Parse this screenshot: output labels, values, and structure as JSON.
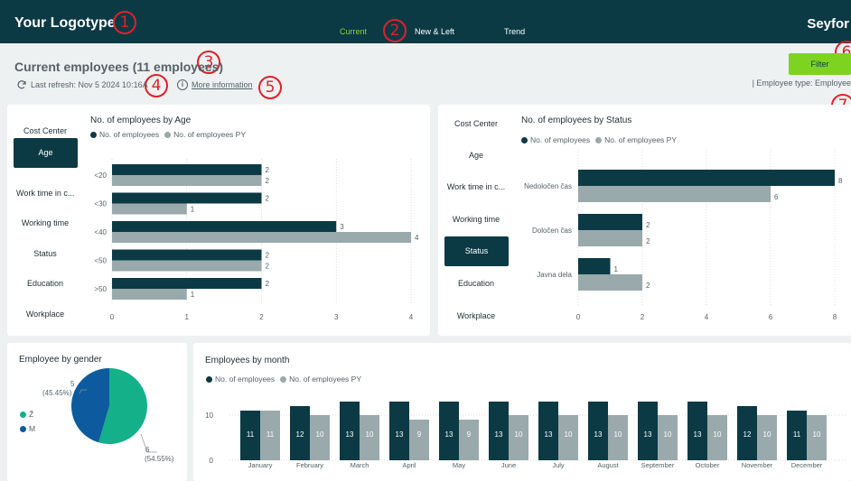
{
  "header": {
    "logo": "Your Logotype",
    "brand": "Seyfor",
    "tabs": [
      {
        "label": "Current",
        "active": true
      },
      {
        "label": "New & Left",
        "active": false
      },
      {
        "label": "Trend",
        "active": false
      }
    ]
  },
  "markers": [
    "1",
    "2",
    "3",
    "4",
    "5",
    "6",
    "7"
  ],
  "page": {
    "title": "Current employees (11 employees)",
    "refresh_text": "Last refresh: Nov 5 2024 10:16A",
    "more_info_label": "More information",
    "info_icon_glyph": "i",
    "filter_label": "Filter",
    "filter_summary": "| Employee type: Employee"
  },
  "colors": {
    "dark": "#0b3a45",
    "light": "#9aa9ab",
    "accent": "#7ed321",
    "female": "#14b08a",
    "male": "#0d5b9e"
  },
  "legend": {
    "current": "No. of employees",
    "previous": "No. of employees PY"
  },
  "left_panel": {
    "menu": [
      "Cost Center",
      "Age",
      "Work time in c...",
      "Working time",
      "Status",
      "Education",
      "Workplace"
    ],
    "selected": "Age"
  },
  "right_panel": {
    "menu": [
      "Cost Center",
      "Age",
      "Work time in c...",
      "Working time",
      "Status",
      "Education",
      "Workplace"
    ],
    "selected": "Status"
  },
  "gender_card": {
    "title": "Employee by gender",
    "legend": [
      "Ž",
      "M"
    ]
  },
  "chart_data": [
    {
      "type": "bar",
      "orientation": "horizontal",
      "title": "No. of employees by Age",
      "categories": [
        "<20",
        "<30",
        "<40",
        "<50",
        ">50"
      ],
      "series": [
        {
          "name": "No. of employees",
          "values": [
            2,
            2,
            3,
            2,
            2
          ]
        },
        {
          "name": "No. of employees PY",
          "values": [
            2,
            1,
            4,
            2,
            1
          ]
        }
      ],
      "xlim": [
        0,
        4
      ],
      "xticks": [
        "0",
        "1",
        "2",
        "3",
        "4"
      ],
      "grid": true,
      "legend": "top-left"
    },
    {
      "type": "bar",
      "orientation": "horizontal",
      "title": "No. of employees by Status",
      "categories": [
        "Nedoločen čas",
        "Določen čas",
        "Javna dela"
      ],
      "series": [
        {
          "name": "No. of employees",
          "values": [
            8,
            2,
            1
          ]
        },
        {
          "name": "No. of employees PY",
          "values": [
            6,
            2,
            2
          ]
        }
      ],
      "xlim": [
        0,
        8
      ],
      "xticks": [
        "0",
        "2",
        "4",
        "6",
        "8"
      ],
      "grid": true,
      "legend": "top-left"
    },
    {
      "type": "pie",
      "title": "Employee by gender",
      "categories": [
        "Ž",
        "M"
      ],
      "values": [
        6,
        5
      ],
      "labels": [
        {
          "value": "6",
          "pct": "(54.55%)"
        },
        {
          "value": "5",
          "pct": "(45.45%)"
        }
      ],
      "legend": "left"
    },
    {
      "type": "bar",
      "orientation": "vertical",
      "title": "Employees by month",
      "categories": [
        "January",
        "February",
        "March",
        "April",
        "May",
        "June",
        "July",
        "August",
        "September",
        "October",
        "November",
        "December"
      ],
      "series": [
        {
          "name": "No. of employees",
          "values": [
            11,
            12,
            13,
            13,
            13,
            13,
            13,
            13,
            13,
            13,
            12,
            11
          ]
        },
        {
          "name": "No. of employees PY",
          "values": [
            11,
            10,
            10,
            9,
            9,
            10,
            10,
            10,
            10,
            10,
            10,
            10
          ]
        }
      ],
      "ylim": [
        0,
        13
      ],
      "yticks": [
        "0",
        "10"
      ],
      "grid": true,
      "legend": "top-left"
    }
  ]
}
